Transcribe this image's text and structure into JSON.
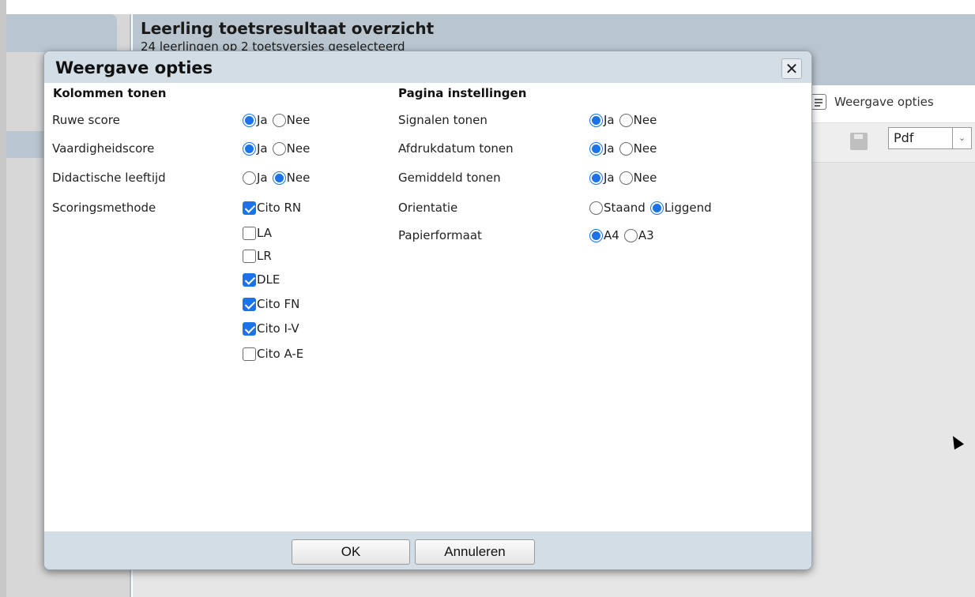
{
  "background": {
    "title": "Leerling toetsresultaat overzicht",
    "subtitle": "24 leerlingen op 2 toetsversies geselecteerd",
    "options_button_label": "Weergave opties",
    "format_select_value": "Pdf"
  },
  "dialog": {
    "title": "Weergave opties",
    "close_glyph": "✕",
    "left_section": {
      "heading": "Kolommen tonen",
      "rows": [
        {
          "label": "Ruwe score",
          "options": [
            "Ja",
            "Nee"
          ],
          "selected": "Ja"
        },
        {
          "label": "Vaardigheidscore",
          "options": [
            "Ja",
            "Nee"
          ],
          "selected": "Ja"
        },
        {
          "label": "Didactische leeftijd",
          "options": [
            "Ja",
            "Nee"
          ],
          "selected": "Nee"
        }
      ],
      "scoring": {
        "label": "Scoringsmethode",
        "items": [
          {
            "label": "Cito RN",
            "checked": true
          },
          {
            "label": "LA",
            "checked": false
          },
          {
            "label": "LR",
            "checked": false
          },
          {
            "label": "DLE",
            "checked": true
          },
          {
            "label": "Cito FN",
            "checked": true
          },
          {
            "label": "Cito I-V",
            "checked": true
          },
          {
            "label": "Cito A-E",
            "checked": false
          }
        ]
      }
    },
    "right_section": {
      "heading": "Pagina instellingen",
      "rows": [
        {
          "label": "Signalen tonen",
          "options": [
            "Ja",
            "Nee"
          ],
          "selected": "Ja"
        },
        {
          "label": "Afdrukdatum tonen",
          "options": [
            "Ja",
            "Nee"
          ],
          "selected": "Ja"
        },
        {
          "label": "Gemiddeld tonen",
          "options": [
            "Ja",
            "Nee"
          ],
          "selected": "Ja"
        },
        {
          "label": "Orientatie",
          "options": [
            "Staand",
            "Liggend"
          ],
          "selected": "Liggend"
        },
        {
          "label": "Papierformaat",
          "options": [
            "A4",
            "A3"
          ],
          "selected": "A4"
        }
      ]
    },
    "ok_label": "OK",
    "cancel_label": "Annuleren"
  },
  "colors": {
    "accent": "#1a73e8",
    "header_bg": "#d3dde6",
    "app_header_bg": "#b9c6d0"
  }
}
